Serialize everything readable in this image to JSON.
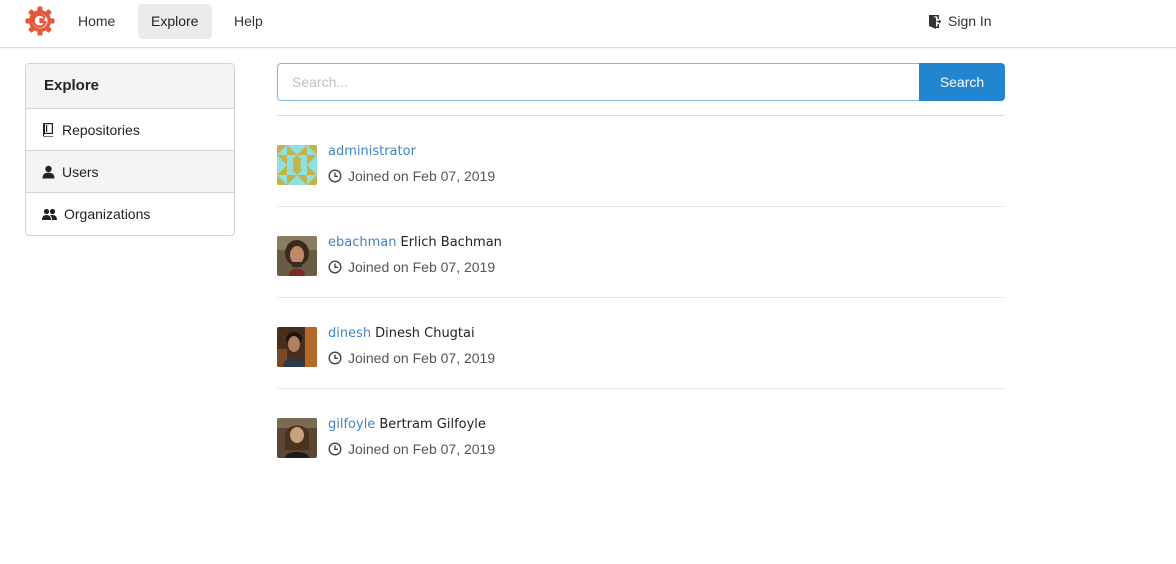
{
  "navbar": {
    "home_label": "Home",
    "explore_label": "Explore",
    "help_label": "Help",
    "signin_label": "Sign In",
    "logo_icon": "gitea-gear-logo",
    "brand_color": "#e5573b"
  },
  "sidebar": {
    "title": "Explore",
    "items": [
      {
        "label": "Repositories",
        "icon": "book-icon",
        "active": false
      },
      {
        "label": "Users",
        "icon": "person-icon",
        "active": true
      },
      {
        "label": "Organizations",
        "icon": "people-icon",
        "active": false
      }
    ]
  },
  "search": {
    "placeholder": "Search...",
    "value": "",
    "button_label": "Search",
    "accent_color": "#2185d0"
  },
  "users": [
    {
      "username": "administrator",
      "full_name": "",
      "joined": "Joined on Feb 07, 2019",
      "avatar": "identicon"
    },
    {
      "username": "ebachman",
      "full_name": "Erlich Bachman",
      "joined": "Joined on Feb 07, 2019",
      "avatar": "photo"
    },
    {
      "username": "dinesh",
      "full_name": "Dinesh Chugtai",
      "joined": "Joined on Feb 07, 2019",
      "avatar": "photo"
    },
    {
      "username": "gilfoyle",
      "full_name": "Bertram Gilfoyle",
      "joined": "Joined on Feb 07, 2019",
      "avatar": "photo"
    }
  ]
}
